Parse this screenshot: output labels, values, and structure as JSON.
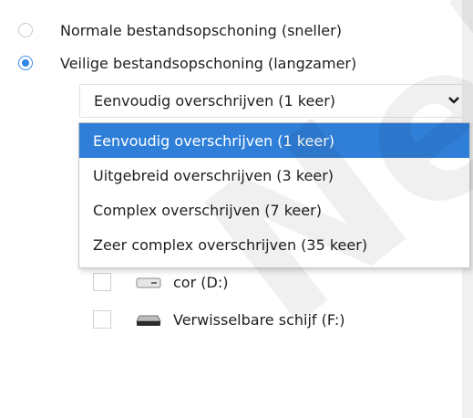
{
  "wipe_options": {
    "normal_label": "Normale bestandsopschoning (sneller)",
    "secure_label": "Veilige bestandsopschoning (langzamer)",
    "selected": "secure"
  },
  "method_select": {
    "value": "Eenvoudig overschrijven (1 keer)",
    "options": [
      "Eenvoudig overschrijven (1 keer)",
      "Uitgebreid overschrijven (3 keer)",
      "Complex overschrijven (7 keer)",
      "Zeer complex overschrijven (35 keer)"
    ],
    "highlighted_index": 0
  },
  "drives": [
    {
      "label": "cor (D:)",
      "icon": "drive-icon",
      "checked": false
    },
    {
      "label": "Verwisselbare schijf (F:)",
      "icon": "removable-drive-icon",
      "checked": false
    }
  ],
  "colors": {
    "accent": "#2f7fd8",
    "radio_checked": "#2f86e8"
  },
  "watermark": {
    "text": "Nel"
  }
}
